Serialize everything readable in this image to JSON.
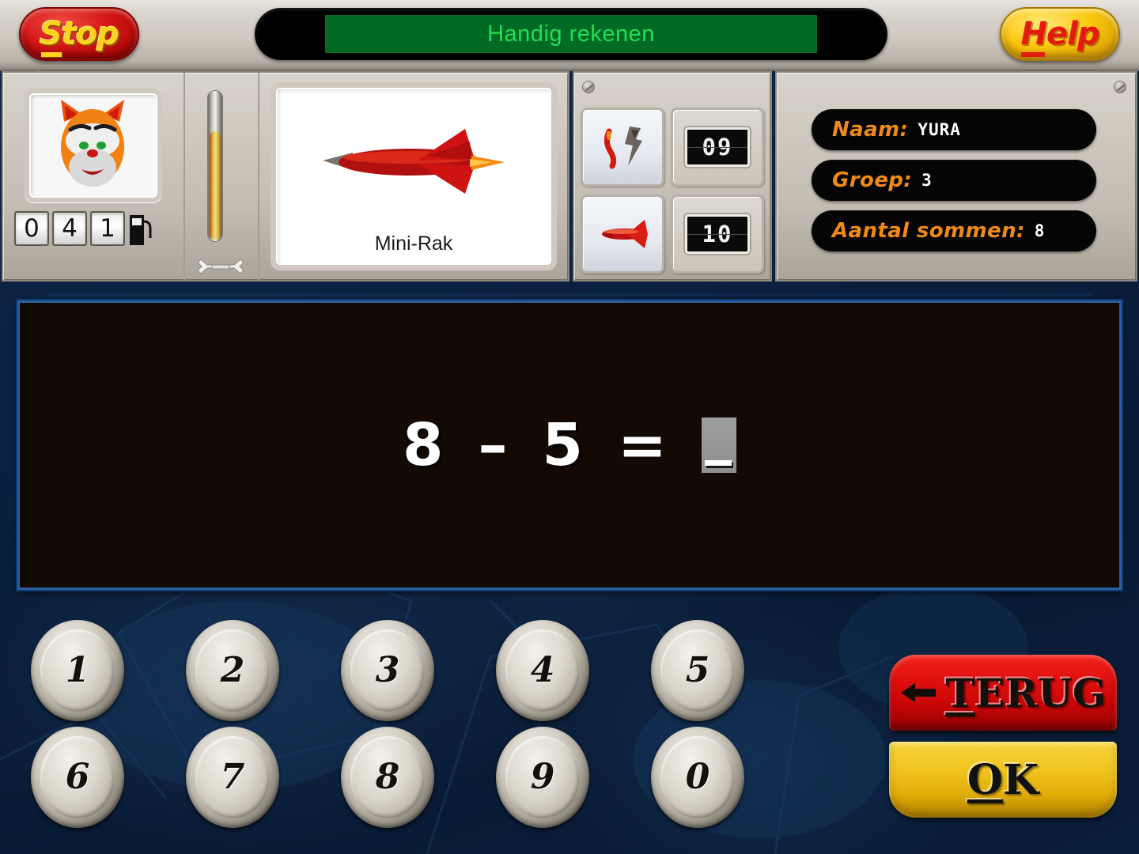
{
  "topbar": {
    "stop_label": "Stop",
    "help_label": "Help",
    "title": "Handig rekenen",
    "stop_icon": "stop-button",
    "help_icon": "help-button"
  },
  "dashboard": {
    "avatar_icon": "cat-avatar",
    "odometer": {
      "digits": [
        "0",
        "4",
        "1"
      ],
      "fuel_icon": "fuel-pump-icon"
    },
    "gauge": {
      "icon": "fuel-gauge",
      "fill_percent": 72,
      "tool_icon": "wrench-icon"
    },
    "vehicle": {
      "image_icon": "red-rocket",
      "name": "Mini-Rak",
      "paw_icon": "paw-print-icon"
    },
    "counters": [
      {
        "icon": "crashed-rocket-icon",
        "value": "09"
      },
      {
        "icon": "rocket-icon",
        "value": "10"
      }
    ],
    "info": [
      {
        "label": "Naam:",
        "value": "YURA"
      },
      {
        "label": "Groep:",
        "value": "3"
      },
      {
        "label": "Aantal sommen:",
        "value": "8"
      }
    ],
    "screw_icon": "screw-icon"
  },
  "exercise": {
    "operand_left": "8",
    "operator": "–",
    "operand_right": "5",
    "equals": "=",
    "answer": "",
    "cursor_icon": "text-cursor"
  },
  "keypad": {
    "row1": [
      "1",
      "2",
      "3",
      "4",
      "5"
    ],
    "row2": [
      "6",
      "7",
      "8",
      "9",
      "0"
    ]
  },
  "actions": {
    "back_label": "TERUG",
    "back_accel": "T",
    "back_rest": "ERUG",
    "back_icon": "arrow-left-icon",
    "ok_accel": "O",
    "ok_rest": "K",
    "ok_label": "OK"
  },
  "colors": {
    "accent_orange": "#f08a16",
    "screen_green": "#22dd55",
    "screen_bg_green": "#016b26",
    "stop_red": "#d41414",
    "help_yellow": "#fcc70d",
    "background_blue": "#0b2141",
    "display_black": "#140a04"
  }
}
